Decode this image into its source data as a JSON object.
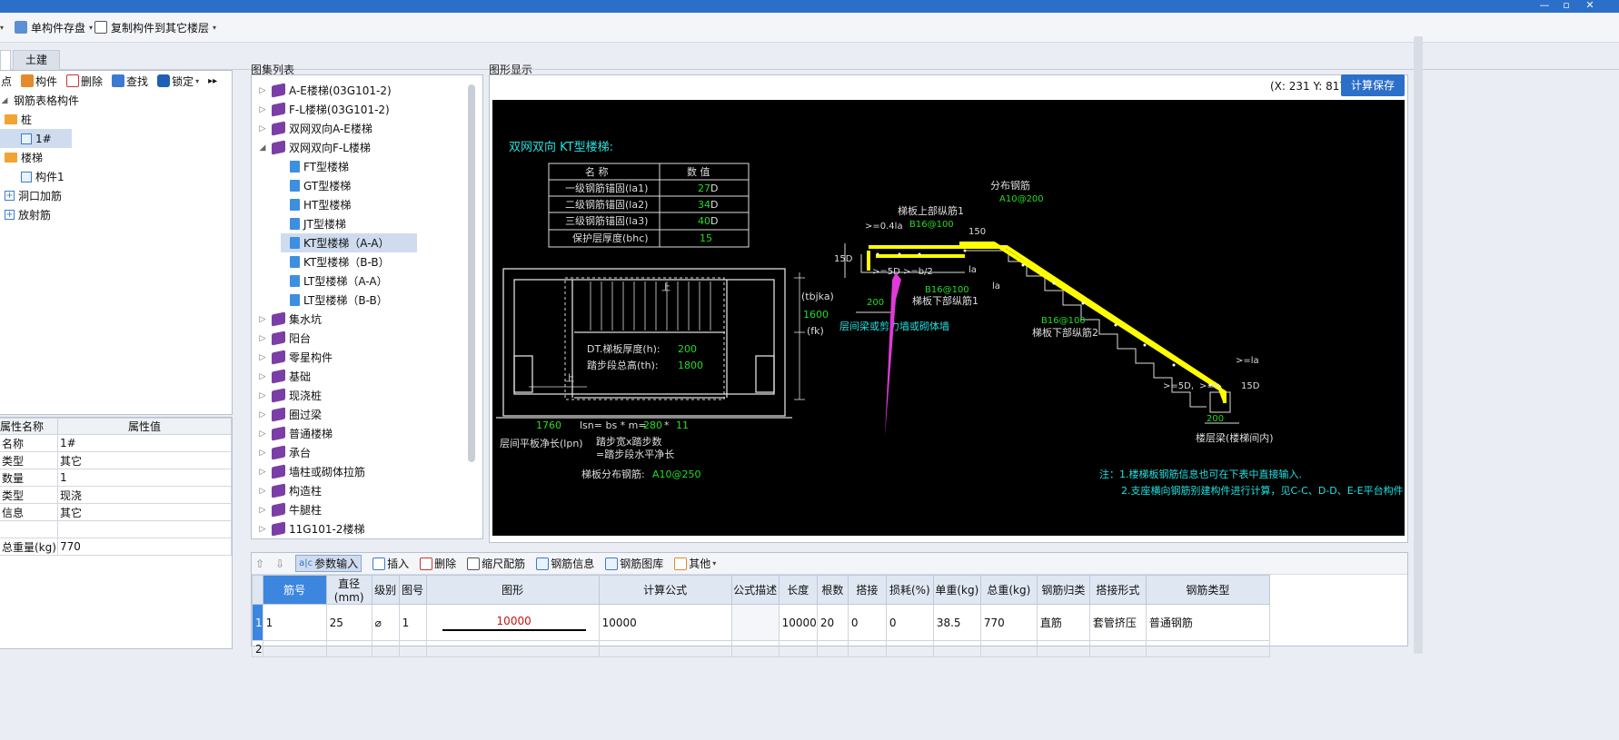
{
  "toolbar": {
    "save_single": "单构件存盘",
    "copy_to_floor": "复制构件到其它楼层"
  },
  "tabs": {
    "civil": "土建"
  },
  "left": {
    "tools": [
      "点",
      "构件",
      "删除",
      "查找",
      "锁定"
    ],
    "tree": {
      "root": "钢筋表格构件",
      "pile": "桩",
      "pile_item": "1#",
      "stair": "楼梯",
      "stair_item": "构件1",
      "opening": "洞口加筋",
      "radial": "放射筋"
    },
    "props": {
      "col_name": "属性名称",
      "col_value": "属性值",
      "rows": [
        [
          "名称",
          "1#"
        ],
        [
          "类型",
          "其它"
        ],
        [
          "数量",
          "1"
        ],
        [
          "类型",
          "现浇"
        ],
        [
          "信息",
          "其它"
        ],
        [
          "",
          ""
        ],
        [
          "总重量(kg)",
          "770"
        ]
      ]
    }
  },
  "atlas": {
    "title": "图集列表",
    "items": [
      "A-E楼梯(03G101-2)",
      "F-L楼梯(03G101-2)",
      "双网双向A-E楼梯",
      "双网双向F-L楼梯",
      "FT型楼梯",
      "GT型楼梯",
      "HT型楼梯",
      "JT型楼梯",
      "KT型楼梯（A-A）",
      "KT型楼梯（B-B）",
      "LT型楼梯（A-A）",
      "LT型楼梯（B-B）",
      "集水坑",
      "阳台",
      "零星构件",
      "基础",
      "现浇桩",
      "圈过梁",
      "普通楼梯",
      "承台",
      "墙柱或砌体拉筋",
      "构造柱",
      "牛腿柱",
      "11G101-2楼梯"
    ]
  },
  "display": {
    "title": "图形显示",
    "coords": "(X: 231 Y: 817)",
    "calc_save": "计算保存"
  },
  "cad": {
    "heading": "双网双向 KT型楼梯:",
    "table_h": [
      "名  称",
      "数  值"
    ],
    "rows": [
      [
        "一级钢筋锚固(la1)",
        "27",
        "D"
      ],
      [
        "二级钢筋锚固(la2)",
        "34",
        "D"
      ],
      [
        "三级钢筋锚固(la3)",
        "40",
        "D"
      ],
      [
        "保护层厚度(bhc)",
        "15",
        ""
      ]
    ],
    "plan": {
      "tbjka": "(tbjka)",
      "v1600": "1600",
      "fk": "(fk)",
      "dt_label": "DT.梯板厚度(h):",
      "dt_val": "200",
      "th_label": "踏步段总高(th):",
      "th_val": "1800",
      "up": "上",
      "v1760": "1760",
      "lsn": "lsn= bs * m=",
      "bs": "280",
      "times": "*",
      "m": "11",
      "lpn": "层间平板净长(lpn)",
      "step": "踏步宽x踏步数",
      "step2": "=踏步段水平净长",
      "dist_label": "梯板分布钢筋:",
      "dist_val": "A10@250"
    },
    "sec": {
      "dist": "分布钢筋",
      "dist_val": "A10@200",
      "top_bar": "梯板上部纵筋1",
      "top_val": "B16@100",
      "la04": ">=0.4la",
      "v150": "150",
      "v15d": "15D",
      "g5d": ">=5D",
      ">b2": ">=b/2",
      "la": "la",
      "v200": "200",
      "b16a": "B16@100",
      "bot1": "梯板下部纵筋1",
      "wall": "层间梁或剪力墙或砌体墙",
      "b16b": "B16@100",
      "bot2": "梯板下部纵筋2",
      "gela": ">=la",
      "g5d2": ">=5D,",
      ">h": ">=h",
      "v15d2": "15D",
      "v200b": "200",
      "floorbeam": "楼层梁(楼梯间内)"
    },
    "note1": "注：1.楼梯板钢筋信息也可在下表中直接输入.",
    "note2": "2.支座横向钢筋别建构件进行计算，见C-C、D-D、E-E平台构件"
  },
  "bottom": {
    "tools": [
      "参数输入",
      "插入",
      "删除",
      "缩尺配筋",
      "钢筋信息",
      "钢筋图库",
      "其他"
    ],
    "headers": [
      "筋号",
      "直径(mm)",
      "级别",
      "图号",
      "图形",
      "计算公式",
      "公式描述",
      "长度",
      "根数",
      "搭接",
      "损耗(%)",
      "单重(kg)",
      "总重(kg)",
      "钢筋归类",
      "搭接形式",
      "钢筋类型"
    ],
    "row1": [
      "1",
      "25",
      "⌀",
      "1",
      "10000",
      "10000",
      "",
      "10000",
      "20",
      "0",
      "0",
      "38.5",
      "770",
      "直筋",
      "套管挤压",
      "普通钢筋"
    ],
    "rownums": [
      "1",
      "2"
    ]
  },
  "colors": {
    "accent": "#2b6fc9",
    "cad_bg": "#000000",
    "cad_green": "#22dd22",
    "cad_cyan": "#22e0e0",
    "rebar": "#ffff00",
    "arrow": "#e03ad8"
  }
}
